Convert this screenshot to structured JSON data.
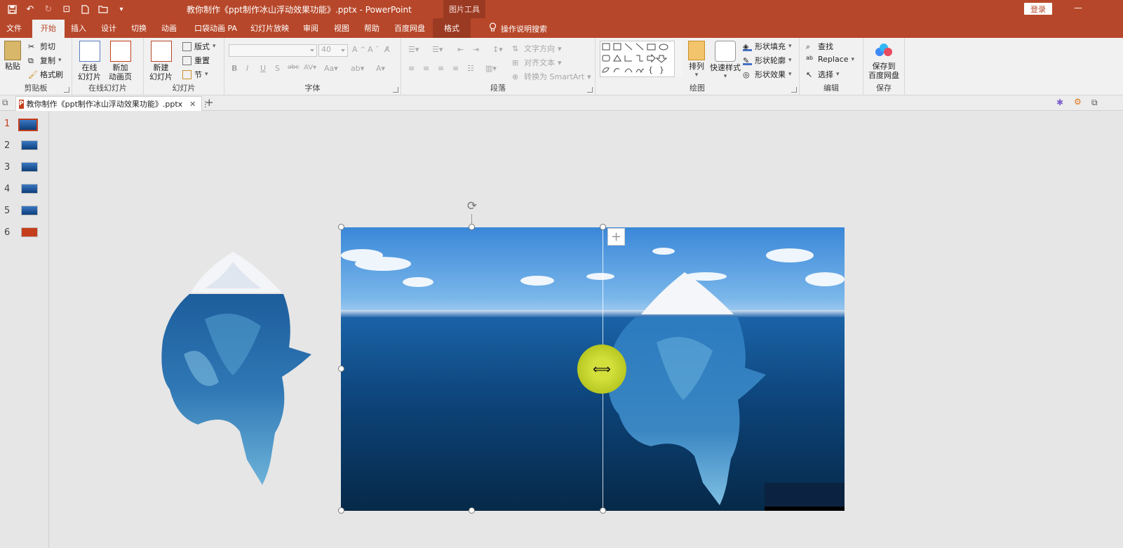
{
  "window": {
    "title": "教你制作《ppt制作冰山浮动效果功能》.pptx  -  PowerPoint",
    "context_group": "图片工具",
    "login": "登录"
  },
  "tabs": [
    {
      "label": "文件"
    },
    {
      "label": "开始"
    },
    {
      "label": "插入"
    },
    {
      "label": "设计"
    },
    {
      "label": "切换"
    },
    {
      "label": "动画"
    },
    {
      "label": "口袋动画 PA"
    },
    {
      "label": "幻灯片放映"
    },
    {
      "label": "审阅"
    },
    {
      "label": "视图"
    },
    {
      "label": "帮助"
    },
    {
      "label": "百度网盘"
    },
    {
      "label": "格式"
    }
  ],
  "tell_me": "操作说明搜索",
  "ribbon": {
    "clipboard": {
      "label": "剪贴板",
      "paste": "粘贴",
      "cut": "剪切",
      "copy": "复制",
      "format_painter": "格式刷"
    },
    "online_slides": {
      "label": "在线幻灯片",
      "online_line1": "在线",
      "online_line2": "幻灯片",
      "new_anim_line1": "新加",
      "new_anim_line2": "动画页"
    },
    "slides": {
      "label": "幻灯片",
      "new_line1": "新建",
      "new_line2": "幻灯片",
      "layout": "版式",
      "reset": "重置",
      "section": "节"
    },
    "font": {
      "label": "字体",
      "size": "40"
    },
    "paragraph": {
      "label": "段落",
      "text_direction": "文字方向",
      "align_text": "对齐文本",
      "smartart": "转换为 SmartArt"
    },
    "drawing": {
      "label": "绘图",
      "arrange": "排列",
      "quick_styles": "快速样式",
      "fill": "形状填充",
      "outline": "形状轮廓",
      "effects": "形状效果"
    },
    "editing": {
      "label": "编辑",
      "find": "查找",
      "replace": "Replace",
      "select": "选择"
    },
    "save": {
      "label": "保存",
      "line1": "保存到",
      "line2": "百度网盘"
    }
  },
  "document_tab": {
    "name": "教你制作《ppt制作冰山浮动效果功能》.pptx"
  },
  "slides": [
    {
      "num": "1"
    },
    {
      "num": "2"
    },
    {
      "num": "3"
    },
    {
      "num": "4"
    },
    {
      "num": "5"
    },
    {
      "num": "6"
    }
  ],
  "colors": {
    "accent": "#b7472a",
    "context_tab": "#9b3a22",
    "selection": "#c43e1c",
    "cursor_highlight": "#c8d62b"
  }
}
